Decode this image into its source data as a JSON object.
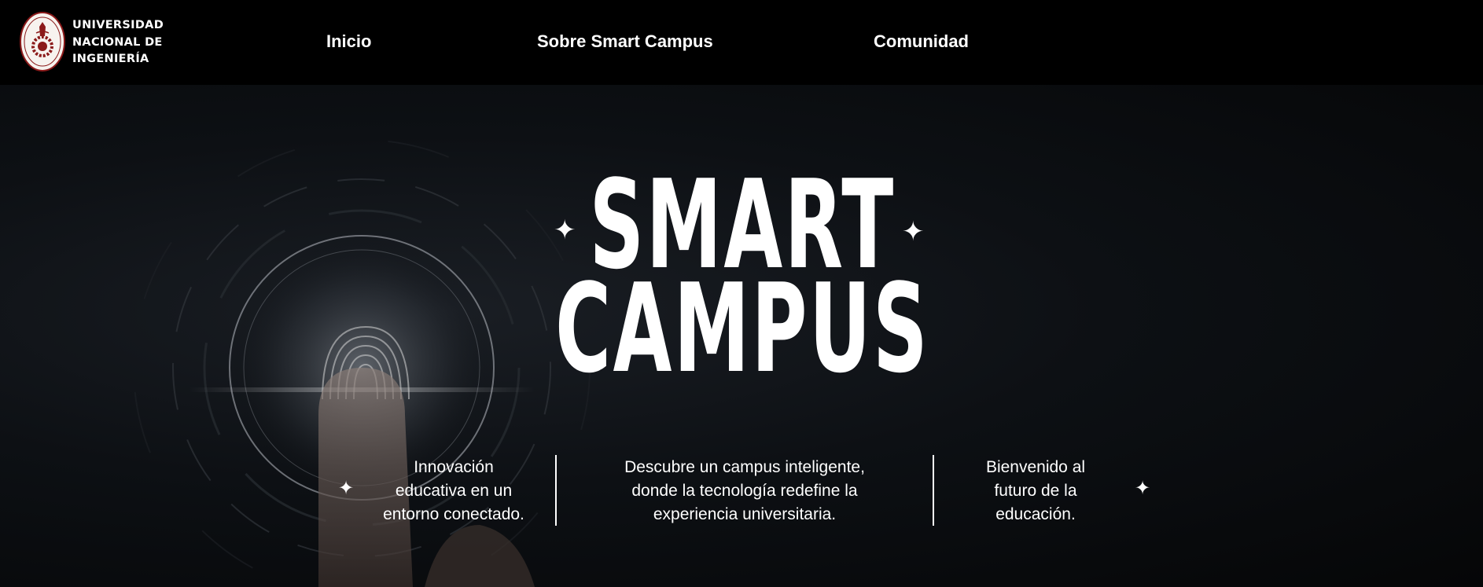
{
  "header": {
    "university_name": [
      "UNIVERSIDAD",
      "NACIONAL DE",
      "INGENIERÍA"
    ],
    "logo_icon": "uni-seal-icon",
    "nav": [
      {
        "label": "Inicio"
      },
      {
        "label": "Sobre Smart Campus"
      },
      {
        "label": "Comunidad"
      }
    ]
  },
  "hero": {
    "title_line1": "SMART",
    "title_line2": "CAMPUS",
    "sparkle_icon": "sparkle-icon",
    "taglines": [
      {
        "lines": [
          "Innovación",
          "educativa en un",
          "entorno conectado."
        ]
      },
      {
        "lines": [
          "Descubre un campus inteligente,",
          "donde la tecnología redefine la",
          "experiencia universitaria."
        ]
      },
      {
        "lines": [
          "Bienvenido al",
          "futuro de la",
          "educación."
        ]
      }
    ]
  },
  "colors": {
    "background": "#000000",
    "text": "#ffffff",
    "logo_accent": "#8b1a1a"
  }
}
